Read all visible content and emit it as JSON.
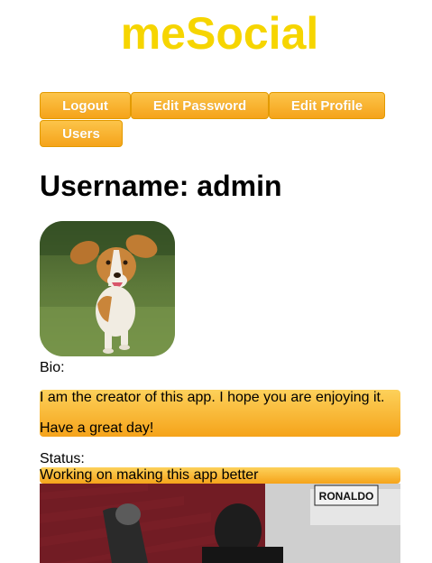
{
  "app": {
    "brand": "meSocial",
    "brand_color": "#f6d500",
    "accent_gradient": [
      "#fcc44a",
      "#f5a31a"
    ]
  },
  "nav": {
    "logout": "Logout",
    "edit_password": "Edit Password",
    "edit_profile": "Edit Profile",
    "users": "Users"
  },
  "profile": {
    "username_heading": "Username: admin",
    "avatar_icon": "dog-photo",
    "bio_label": "Bio:",
    "bio_lines": [
      "I am the creator of this app. I hope you are enjoying it.",
      "Have a great day!"
    ],
    "status_label": "Status:",
    "status_text": "Working on making this app better"
  },
  "banner": {
    "image": "football-poster",
    "sign_text": "RONALDO"
  }
}
